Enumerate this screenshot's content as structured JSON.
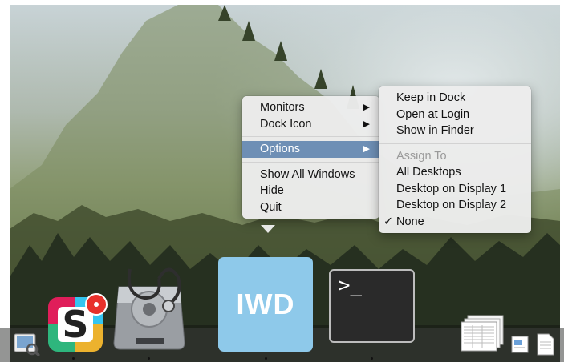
{
  "context_menu": {
    "items": [
      {
        "label": "Monitors",
        "submenu": true
      },
      {
        "label": "Dock Icon",
        "submenu": true
      },
      {
        "label": "Options",
        "submenu": true,
        "selected": true
      },
      {
        "label": "Show All Windows"
      },
      {
        "label": "Hide"
      },
      {
        "label": "Quit"
      }
    ]
  },
  "options_submenu": {
    "items": [
      {
        "label": "Keep in Dock"
      },
      {
        "label": "Open at Login"
      },
      {
        "label": "Show in Finder"
      }
    ],
    "assign_to_header": "Assign To",
    "assign_items": [
      {
        "label": "All Desktops",
        "checked": false
      },
      {
        "label": "Desktop on Display 1",
        "checked": false
      },
      {
        "label": "Desktop on Display 2",
        "checked": false
      },
      {
        "label": "None",
        "checked": true
      }
    ],
    "check_glyph": "✓"
  },
  "dock": {
    "apps": [
      {
        "name": "preview",
        "icon": "preview-icon"
      },
      {
        "name": "slack",
        "icon": "slack-icon",
        "letter": "S",
        "badge": true
      },
      {
        "name": "disk-utility",
        "icon": "disk-utility-icon"
      },
      {
        "name": "iwd",
        "icon": "iwd-icon",
        "label": "IWD"
      },
      {
        "name": "terminal",
        "icon": "terminal-icon",
        "prompt": ">_"
      }
    ],
    "stacks": [
      {
        "name": "documents-stack",
        "icon": "document-stack-icon"
      },
      {
        "name": "file-1",
        "icon": "document-icon"
      },
      {
        "name": "file-2",
        "icon": "document-icon"
      }
    ]
  },
  "colors": {
    "menu_selection": "#6e8fb5",
    "iwd_bg": "#8ec9ea",
    "badge": "#e8312b"
  }
}
